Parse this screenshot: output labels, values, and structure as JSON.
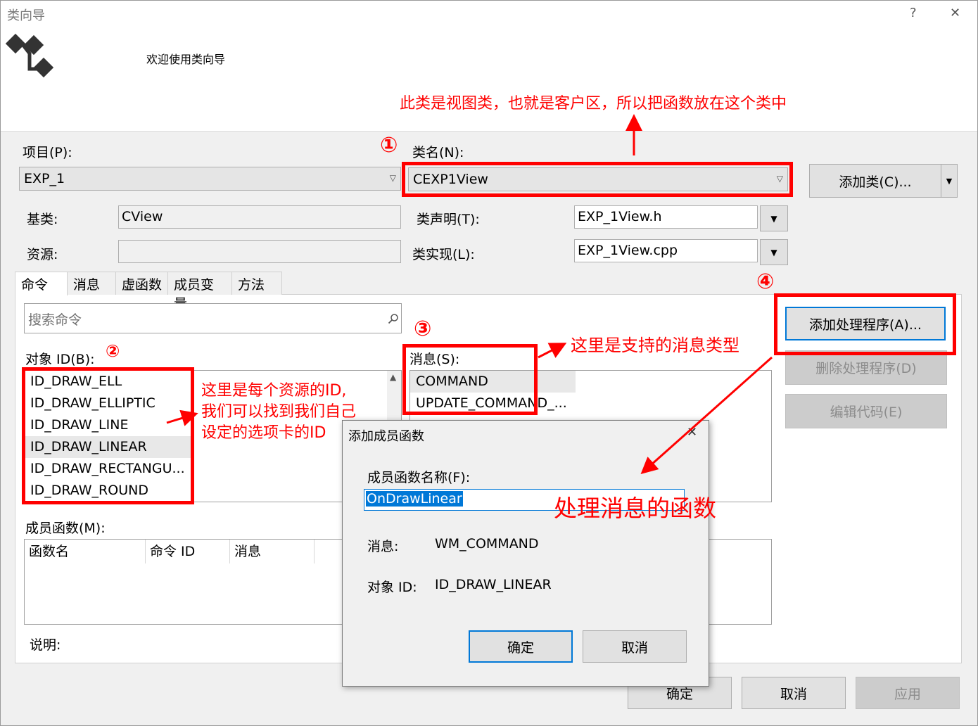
{
  "window": {
    "title": "类向导",
    "help": "?",
    "close": "✕"
  },
  "banner": {
    "welcome": "欢迎使用类向导"
  },
  "project": {
    "label": "项目(P):",
    "value": "EXP_1"
  },
  "classname": {
    "label": "类名(N):",
    "value": "CEXP1View"
  },
  "add_class_button": "添加类(C)...",
  "base_class": {
    "label": "基类:",
    "value": "CView"
  },
  "resource": {
    "label": "资源:",
    "value": ""
  },
  "class_decl": {
    "label": "类声明(T):",
    "value": "EXP_1View.h"
  },
  "class_impl": {
    "label": "类实现(L):",
    "value": "EXP_1View.cpp"
  },
  "tabs": [
    "命令",
    "消息",
    "虚函数",
    "成员变量",
    "方法"
  ],
  "search": {
    "placeholder": "搜索命令"
  },
  "object_ids": {
    "label": "对象 ID(B):",
    "items": [
      "ID_DRAW_ELL",
      "ID_DRAW_ELLIPTIC",
      "ID_DRAW_LINE",
      "ID_DRAW_LINEAR",
      "ID_DRAW_RECTANGU...",
      "ID_DRAW_ROUND"
    ]
  },
  "messages": {
    "label": "消息(S):",
    "items": [
      "COMMAND",
      "UPDATE_COMMAND_..."
    ]
  },
  "handler_buttons": {
    "add": "添加处理程序(A)...",
    "delete": "删除处理程序(D)",
    "edit": "编辑代码(E)"
  },
  "member_functions": {
    "label": "成员函数(M):",
    "columns": [
      "函数名",
      "命令 ID",
      "消息"
    ]
  },
  "description": {
    "label": "说明:"
  },
  "footer": {
    "ok": "确定",
    "cancel": "取消",
    "apply": "应用"
  },
  "dialog": {
    "title": "添加成员函数",
    "close": "✕",
    "name_label": "成员函数名称(F):",
    "name_value": "OnDrawLinear",
    "message_label": "消息:",
    "message_value": "WM_COMMAND",
    "object_label": "对象 ID:",
    "object_value": "ID_DRAW_LINEAR",
    "ok": "确定",
    "cancel": "取消"
  },
  "annotations": {
    "c1": "①",
    "c2": "②",
    "c3": "③",
    "c4": "④",
    "view_class_note": "此类是视图类，也就是客户区，所以把函数放在这个类中",
    "id_note_1": "这里是每个资源的ID,",
    "id_note_2": "我们可以找到我们自己",
    "id_note_3": "设定的选项卡的ID",
    "msg_note": "这里是支持的消息类型",
    "func_note": "处理消息的函数"
  },
  "colors": {
    "annotation": "#ff0000",
    "focus": "#0078d7",
    "selection": "#0078d7"
  }
}
